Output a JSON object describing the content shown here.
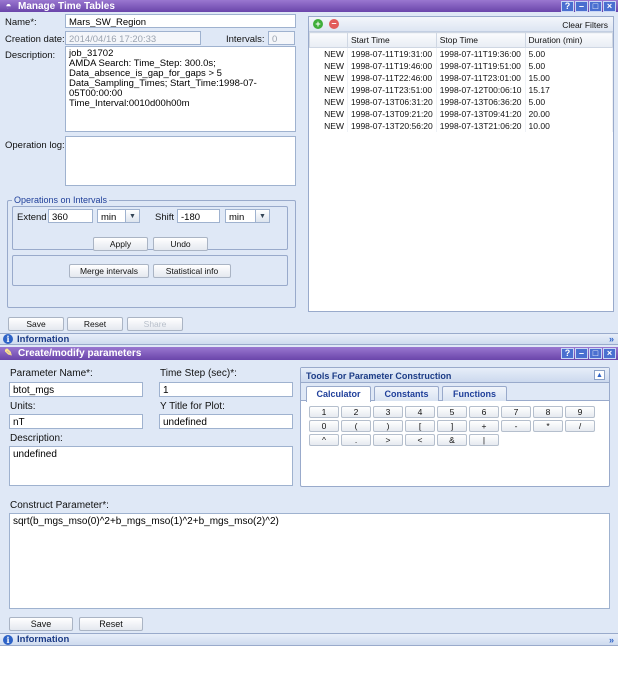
{
  "timetables": {
    "title": "Manage Time Tables",
    "name_label": "Name*:",
    "name_value": "Mars_SW_Region",
    "creation_label": "Creation date:",
    "creation_value": "2014/04/16 17:20:33",
    "intervals_label": "Intervals:",
    "intervals_value": "0",
    "description_label": "Description:",
    "description_lines": [
      "job_31702",
      "AMDA Search: Time_Step: 300.0s;",
      "Data_absence_is_gap_for_gaps >     5",
      "Data_Sampling_Times; Start_Time:1998-07-05T00:00:00",
      "Time_Interval:0010d00h00m"
    ],
    "oplog_label": "Operation log:",
    "operations_legend": "Operations on Intervals",
    "extend_label": "Extend",
    "extend_value": "360",
    "extend_unit": "min",
    "shift_label": "Shift",
    "shift_value": "-180",
    "shift_unit": "min",
    "apply_label": "Apply",
    "undo_label": "Undo",
    "merge_label": "Merge intervals",
    "statistical_label": "Statistical info",
    "save_label": "Save",
    "reset_label": "Reset",
    "share_label": "Share",
    "clear_filters_label": "Clear Filters",
    "columns": [
      "",
      "Start Time",
      "Stop Time",
      "Duration (min)"
    ],
    "rows": [
      [
        "NEW",
        "1998-07-11T19:31:00",
        "1998-07-11T19:36:00",
        "5.00"
      ],
      [
        "NEW",
        "1998-07-11T19:46:00",
        "1998-07-11T19:51:00",
        "5.00"
      ],
      [
        "NEW",
        "1998-07-11T22:46:00",
        "1998-07-11T23:01:00",
        "15.00"
      ],
      [
        "NEW",
        "1998-07-11T23:51:00",
        "1998-07-12T00:06:10",
        "15.17"
      ],
      [
        "NEW",
        "1998-07-13T06:31:20",
        "1998-07-13T06:36:20",
        "5.00"
      ],
      [
        "NEW",
        "1998-07-13T09:21:20",
        "1998-07-13T09:41:20",
        "20.00"
      ],
      [
        "NEW",
        "1998-07-13T20:56:20",
        "1998-07-13T21:06:20",
        "10.00"
      ]
    ],
    "info_label": "Information"
  },
  "params": {
    "title": "Create/modify parameters",
    "param_name_label": "Parameter Name*:",
    "param_name_value": "btot_mgs",
    "timestep_label": "Time Step (sec)*:",
    "timestep_value": "1",
    "units_label": "Units:",
    "units_value": "nT",
    "ytitle_label": "Y Title for Plot:",
    "ytitle_value": "undefined",
    "description_label": "Description:",
    "description_value": "undefined",
    "construct_label": "Construct Parameter*:",
    "construct_value": "sqrt(b_mgs_mso(0)^2+b_mgs_mso(1)^2+b_mgs_mso(2)^2)",
    "save_label": "Save",
    "reset_label": "Reset",
    "info_label": "Information",
    "tools_title": "Tools For Parameter Construction",
    "tabs": [
      "Calculator",
      "Constants",
      "Functions"
    ],
    "calc_rows": [
      [
        "1",
        "2",
        "3",
        "4",
        "5",
        "6",
        "7",
        "8",
        "9"
      ],
      [
        "0",
        "(",
        ")",
        "[",
        "]",
        "+",
        "-",
        "*",
        "/"
      ],
      [
        "^",
        ".",
        ">",
        "<",
        "&",
        "|"
      ]
    ]
  },
  "colors": {
    "title_bar": "#7a55b9",
    "panel_bg": "#dfe8f6",
    "accent": "#1f3f9a"
  }
}
